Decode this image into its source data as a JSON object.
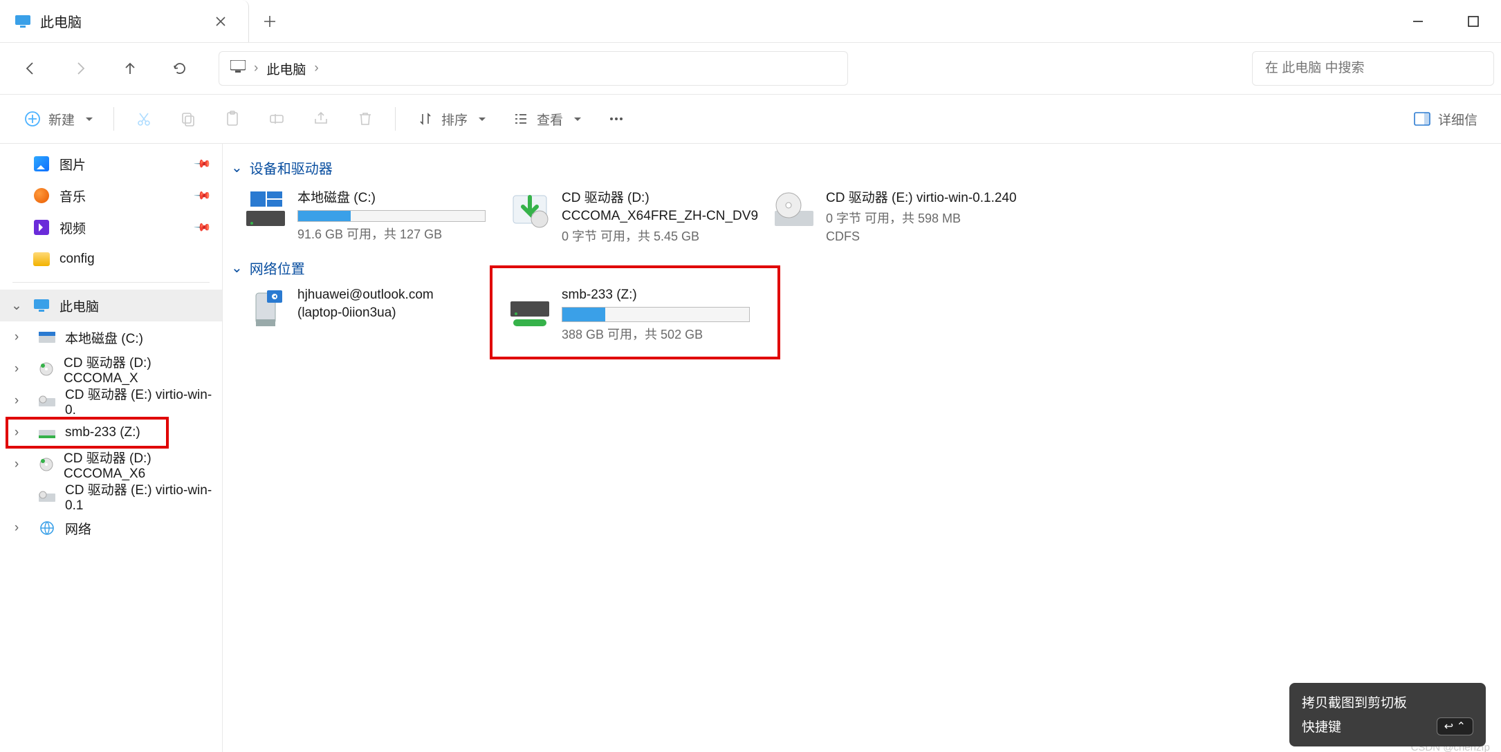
{
  "titlebar": {
    "tab_title": "此电脑"
  },
  "addrbar": {
    "location_label": "此电脑"
  },
  "search": {
    "placeholder": "在 此电脑 中搜索"
  },
  "toolbar": {
    "new_label": "新建",
    "sort_label": "排序",
    "view_label": "查看",
    "details_label": "详细信"
  },
  "sidebar": {
    "quick": [
      {
        "label": "图片",
        "icon": "picture",
        "pinned": true
      },
      {
        "label": "音乐",
        "icon": "music",
        "pinned": true
      },
      {
        "label": "视频",
        "icon": "video",
        "pinned": true
      },
      {
        "label": "config",
        "icon": "folder",
        "pinned": false
      }
    ],
    "this_pc_label": "此电脑",
    "drives": [
      {
        "label": "本地磁盘 (C:)"
      },
      {
        "label": "CD 驱动器 (D:) CCCOMA_X"
      },
      {
        "label": "CD 驱动器 (E:) virtio-win-0."
      },
      {
        "label": "smb-233 (Z:)",
        "highlight": true
      },
      {
        "label": "CD 驱动器 (D:) CCCOMA_X6"
      },
      {
        "label": "CD 驱动器 (E:) virtio-win-0.1"
      }
    ],
    "network_label": "网络"
  },
  "content": {
    "section_devices": "设备和驱动器",
    "section_network": "网络位置",
    "devices": [
      {
        "name": "本地磁盘 (C:)",
        "sub": "91.6 GB 可用，共 127 GB",
        "fill_pct": 28,
        "icon": "os-drive"
      },
      {
        "name": "CD 驱动器 (D:)",
        "line2": "CCCOMA_X64FRE_ZH-CN_DV9",
        "sub": "0 字节 可用，共 5.45 GB",
        "icon": "dvd-install"
      },
      {
        "name": "CD 驱动器 (E:) virtio-win-0.1.240",
        "sub": "0 字节 可用，共 598 MB",
        "sub2": "CDFS",
        "icon": "dvd"
      }
    ],
    "network": [
      {
        "name": "hjhuawei@outlook.com",
        "line2": "(laptop-0iion3ua)",
        "icon": "media-server"
      },
      {
        "name": "smb-233 (Z:)",
        "sub": "388 GB 可用，共 502 GB",
        "fill_pct": 23,
        "icon": "net-drive",
        "highlight": true
      }
    ]
  },
  "toast": {
    "title": "拷贝截图到剪切板",
    "row_label": "快捷键",
    "key_hint": "↩  ⌃"
  },
  "watermark": "CSDN @chenzfp"
}
